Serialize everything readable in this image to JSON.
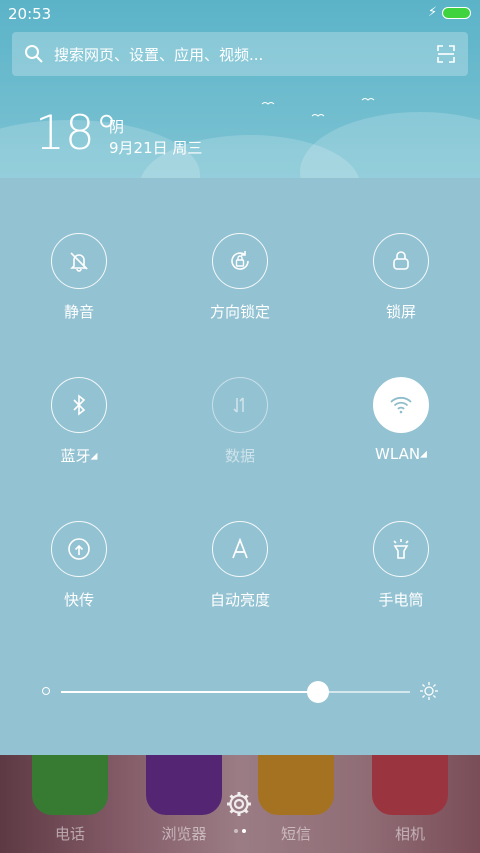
{
  "status_bar": {
    "time": "20:53"
  },
  "search": {
    "placeholder": "搜索网页、设置、应用、视频..."
  },
  "weather": {
    "temperature": "18°",
    "condition": "阴",
    "date": "9月21日 周三"
  },
  "toggles": [
    {
      "label": "静音",
      "icon": "bell-off-icon",
      "state": "off"
    },
    {
      "label": "方向锁定",
      "icon": "rotation-lock-icon",
      "state": "off"
    },
    {
      "label": "锁屏",
      "icon": "lock-icon",
      "state": "off"
    },
    {
      "label": "蓝牙",
      "icon": "bluetooth-icon",
      "state": "off",
      "expandable": true
    },
    {
      "label": "数据",
      "icon": "mobile-data-icon",
      "state": "disabled"
    },
    {
      "label": "WLAN",
      "icon": "wifi-icon",
      "state": "on",
      "expandable": true
    },
    {
      "label": "快传",
      "icon": "quick-transfer-icon",
      "state": "off"
    },
    {
      "label": "自动亮度",
      "icon": "auto-brightness-icon",
      "state": "off"
    },
    {
      "label": "手电筒",
      "icon": "flashlight-icon",
      "state": "off"
    }
  ],
  "brightness": {
    "level": 0.736
  },
  "dock": {
    "apps": [
      {
        "label": "电话",
        "color": "#3fae3a"
      },
      {
        "label": "浏览器",
        "color": "#6a2a9c"
      },
      {
        "label": "短信",
        "color": "#e8a020"
      },
      {
        "label": "相机",
        "color": "#d8434e"
      }
    ],
    "page_indicator": {
      "count": 2,
      "current": 2
    }
  },
  "colors": {
    "panel": "#93c2d2",
    "battery": "#3fd43f",
    "header": "#5bb3c8"
  }
}
